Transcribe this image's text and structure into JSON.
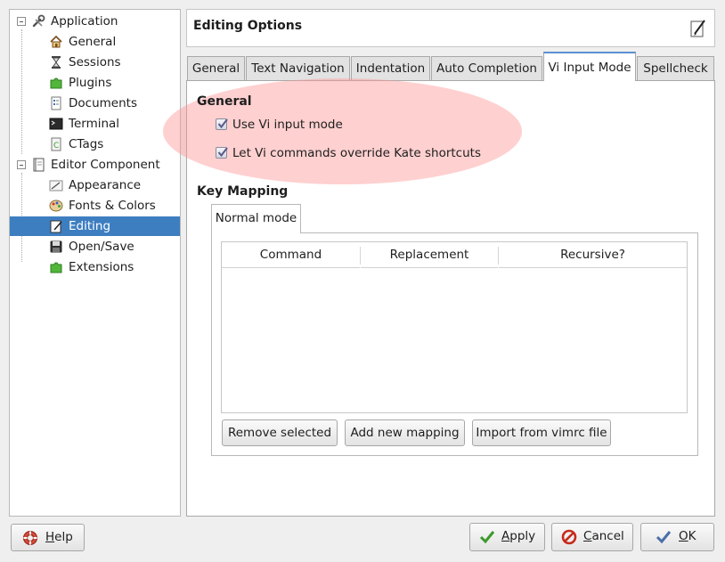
{
  "sidebar": {
    "groups": [
      {
        "label": "Application",
        "icon": "tools-icon",
        "items": [
          {
            "label": "General",
            "icon": "home-icon"
          },
          {
            "label": "Sessions",
            "icon": "hourglass-icon"
          },
          {
            "label": "Plugins",
            "icon": "puzzle-icon"
          },
          {
            "label": "Documents",
            "icon": "document-list-icon"
          },
          {
            "label": "Terminal",
            "icon": "terminal-icon"
          },
          {
            "label": "CTags",
            "icon": "ctags-icon"
          }
        ]
      },
      {
        "label": "Editor Component",
        "icon": "notebook-icon",
        "items": [
          {
            "label": "Appearance",
            "icon": "appearance-icon"
          },
          {
            "label": "Fonts & Colors",
            "icon": "palette-icon"
          },
          {
            "label": "Editing",
            "icon": "editing-icon",
            "selected": true
          },
          {
            "label": "Open/Save",
            "icon": "save-icon"
          },
          {
            "label": "Extensions",
            "icon": "puzzle-icon"
          }
        ]
      }
    ]
  },
  "header": {
    "title": "Editing Options",
    "icon": "edit-pencil-icon"
  },
  "tabs": [
    {
      "label": "General"
    },
    {
      "label": "Text Navigation"
    },
    {
      "label": "Indentation"
    },
    {
      "label": "Auto Completion"
    },
    {
      "label": "Vi Input Mode",
      "active": true
    },
    {
      "label": "Spellcheck"
    }
  ],
  "general_section": {
    "title": "General",
    "options": [
      {
        "label": "Use Vi input mode",
        "checked": true
      },
      {
        "label": "Let Vi commands override Kate shortcuts",
        "checked": true
      }
    ]
  },
  "key_mapping": {
    "title": "Key Mapping",
    "mode_tab": "Normal mode",
    "columns": [
      "Command",
      "Replacement",
      "Recursive?"
    ],
    "rows": [],
    "buttons": {
      "remove": "Remove selected",
      "add": "Add new mapping",
      "import": "Import from vimrc file"
    }
  },
  "footer": {
    "help": {
      "label": "Help",
      "mnemonic": "H",
      "rest": "elp",
      "icon": "help-lifebuoy-icon"
    },
    "apply": {
      "label": "Apply",
      "mnemonic": "A",
      "rest": "pply",
      "icon": "check-icon"
    },
    "cancel": {
      "label": "Cancel",
      "mnemonic": "C",
      "rest": "ancel",
      "icon": "cancel-icon"
    },
    "ok": {
      "label": "OK",
      "mnemonic": "O",
      "rest": "K",
      "icon": "check-icon"
    }
  },
  "colors": {
    "selection": "#3d7ec1",
    "active_tab_accent": "#5b8fd3",
    "highlight": "#ff9696",
    "check_green": "#3b9a2c",
    "cancel_red": "#c72a1c"
  }
}
